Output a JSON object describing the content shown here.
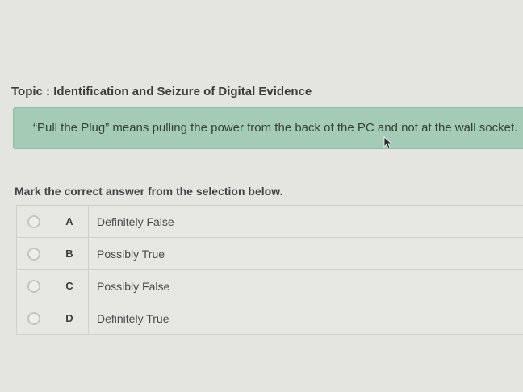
{
  "topic": "Topic : Identification and Seizure of Digital Evidence",
  "statement": "“Pull the Plug” means pulling the power from the back of the PC and not at the wall socket.",
  "instruction": "Mark the correct answer from the selection below.",
  "answers": [
    {
      "letter": "A",
      "text": "Definitely False"
    },
    {
      "letter": "B",
      "text": "Possibly True"
    },
    {
      "letter": "C",
      "text": "Possibly False"
    },
    {
      "letter": "D",
      "text": "Definitely True"
    }
  ],
  "colors": {
    "statement_bg": "#a3cbb6",
    "page_bg": "#e4e4e1"
  }
}
